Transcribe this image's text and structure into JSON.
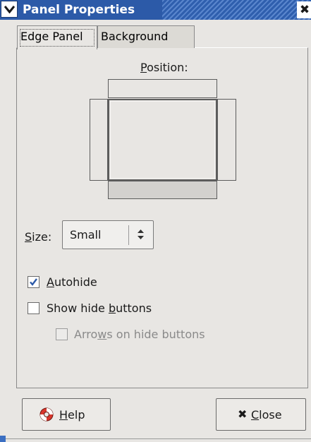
{
  "window": {
    "title": "Panel Properties",
    "close_glyph": "✖",
    "menu_icon": "chevron-down-icon"
  },
  "tabs": [
    {
      "label": "Edge Panel",
      "active": true
    },
    {
      "label": "Background",
      "active": false
    }
  ],
  "position": {
    "label_mnemonic": "P",
    "label_rest": "osition:",
    "selected_edge": "bottom"
  },
  "size": {
    "label_mnemonic": "S",
    "label_rest": "ize:",
    "value": "Small"
  },
  "options": {
    "autohide": {
      "mnemonic": "A",
      "rest": "utohide",
      "checked": true,
      "enabled": true
    },
    "show_hide_buttons": {
      "before": "Show hide ",
      "mnemonic": "b",
      "after": "uttons",
      "checked": false,
      "enabled": true
    },
    "arrows_on_hide_buttons": {
      "before": "Arro",
      "mnemonic": "w",
      "after": "s on hide buttons",
      "checked": false,
      "enabled": false
    }
  },
  "buttons": {
    "help": {
      "mnemonic": "H",
      "rest": "elp",
      "icon": "lifebuoy-icon"
    },
    "close": {
      "mnemonic": "C",
      "rest": "lose",
      "icon": "close-x-icon",
      "glyph": "✖"
    }
  },
  "colors": {
    "titlebar": "#2c5aa8",
    "titlebar_stripe": "#5a86cd",
    "window_bg": "#e8e6e3",
    "selected_edge_fill": "#d3d1ce"
  }
}
